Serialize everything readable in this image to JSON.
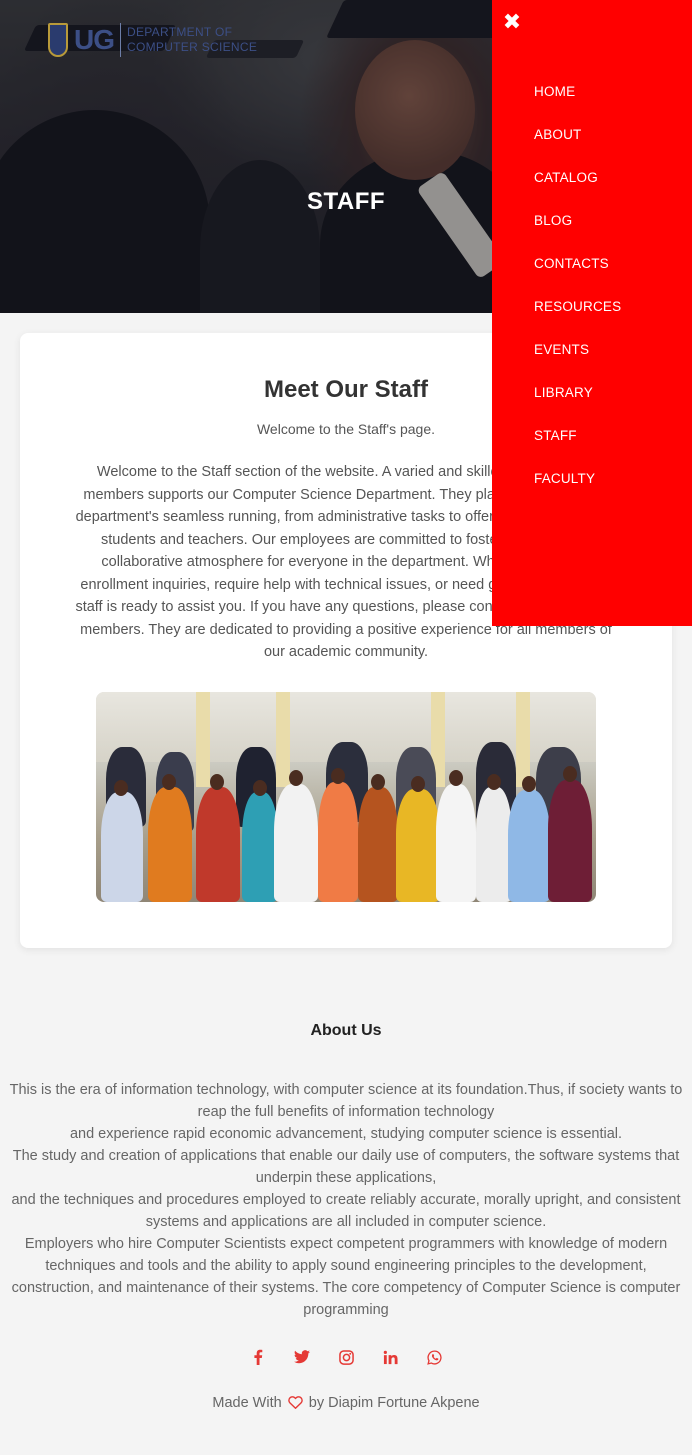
{
  "header": {
    "logo": {
      "mark": "UG",
      "line1": "DEPARTMENT OF",
      "line2": "COMPUTER SCIENCE"
    },
    "hero_title": "STAFF"
  },
  "menu": {
    "close_icon": "close-icon",
    "items": [
      {
        "label": "HOME"
      },
      {
        "label": "ABOUT"
      },
      {
        "label": "CATALOG"
      },
      {
        "label": "BLOG"
      },
      {
        "label": "CONTACTS"
      },
      {
        "label": "RESOURCES"
      },
      {
        "label": "EVENTS"
      },
      {
        "label": "LIBRARY"
      },
      {
        "label": "STAFF"
      },
      {
        "label": "FACULTY"
      }
    ],
    "background": "#ff0000"
  },
  "staff": {
    "title": "Meet Our Staff",
    "subtitle": "Welcome to the Staff's page.",
    "body": "Welcome to the Staff section of the website. A varied and skilled group of staff members supports our Computer Science Department. They play a key role in the department's seamless running, from administrative tasks to offering vital support for students and teachers. Our employees are committed to fostering a positive, collaborative atmosphere for everyone in the department. Whether you have enrollment inquiries, require help with technical issues, or need general advice, our staff is ready to assist you. If you have any questions, please contact one of our staff members. They are dedicated to providing a positive experience for all members of our academic community."
  },
  "about": {
    "title": "About Us",
    "paragraphs": [
      "This is the era of information technology, with computer science at its foundation.Thus, if society wants to reap the full benefits of information technology",
      "and experience rapid economic advancement, studying computer science is essential.",
      "The study and creation of applications that enable our daily use of computers, the software systems that underpin these applications,",
      "and the techniques and procedures employed to create reliably accurate, morally upright, and consistent systems and applications are all included in computer science.",
      "Employers who hire Computer Scientists expect competent programmers with knowledge of modern techniques and tools and the ability to apply sound engineering principles to the development, construction, and maintenance of their systems. The core competency of Computer Science is computer programming"
    ]
  },
  "footer": {
    "socials": [
      "facebook-icon",
      "twitter-icon",
      "instagram-icon",
      "linkedin-icon",
      "whatsapp-icon"
    ],
    "credit_prefix": "Made With",
    "credit_suffix": "by Diapim Fortune Akpene",
    "accent": "#e53935"
  }
}
